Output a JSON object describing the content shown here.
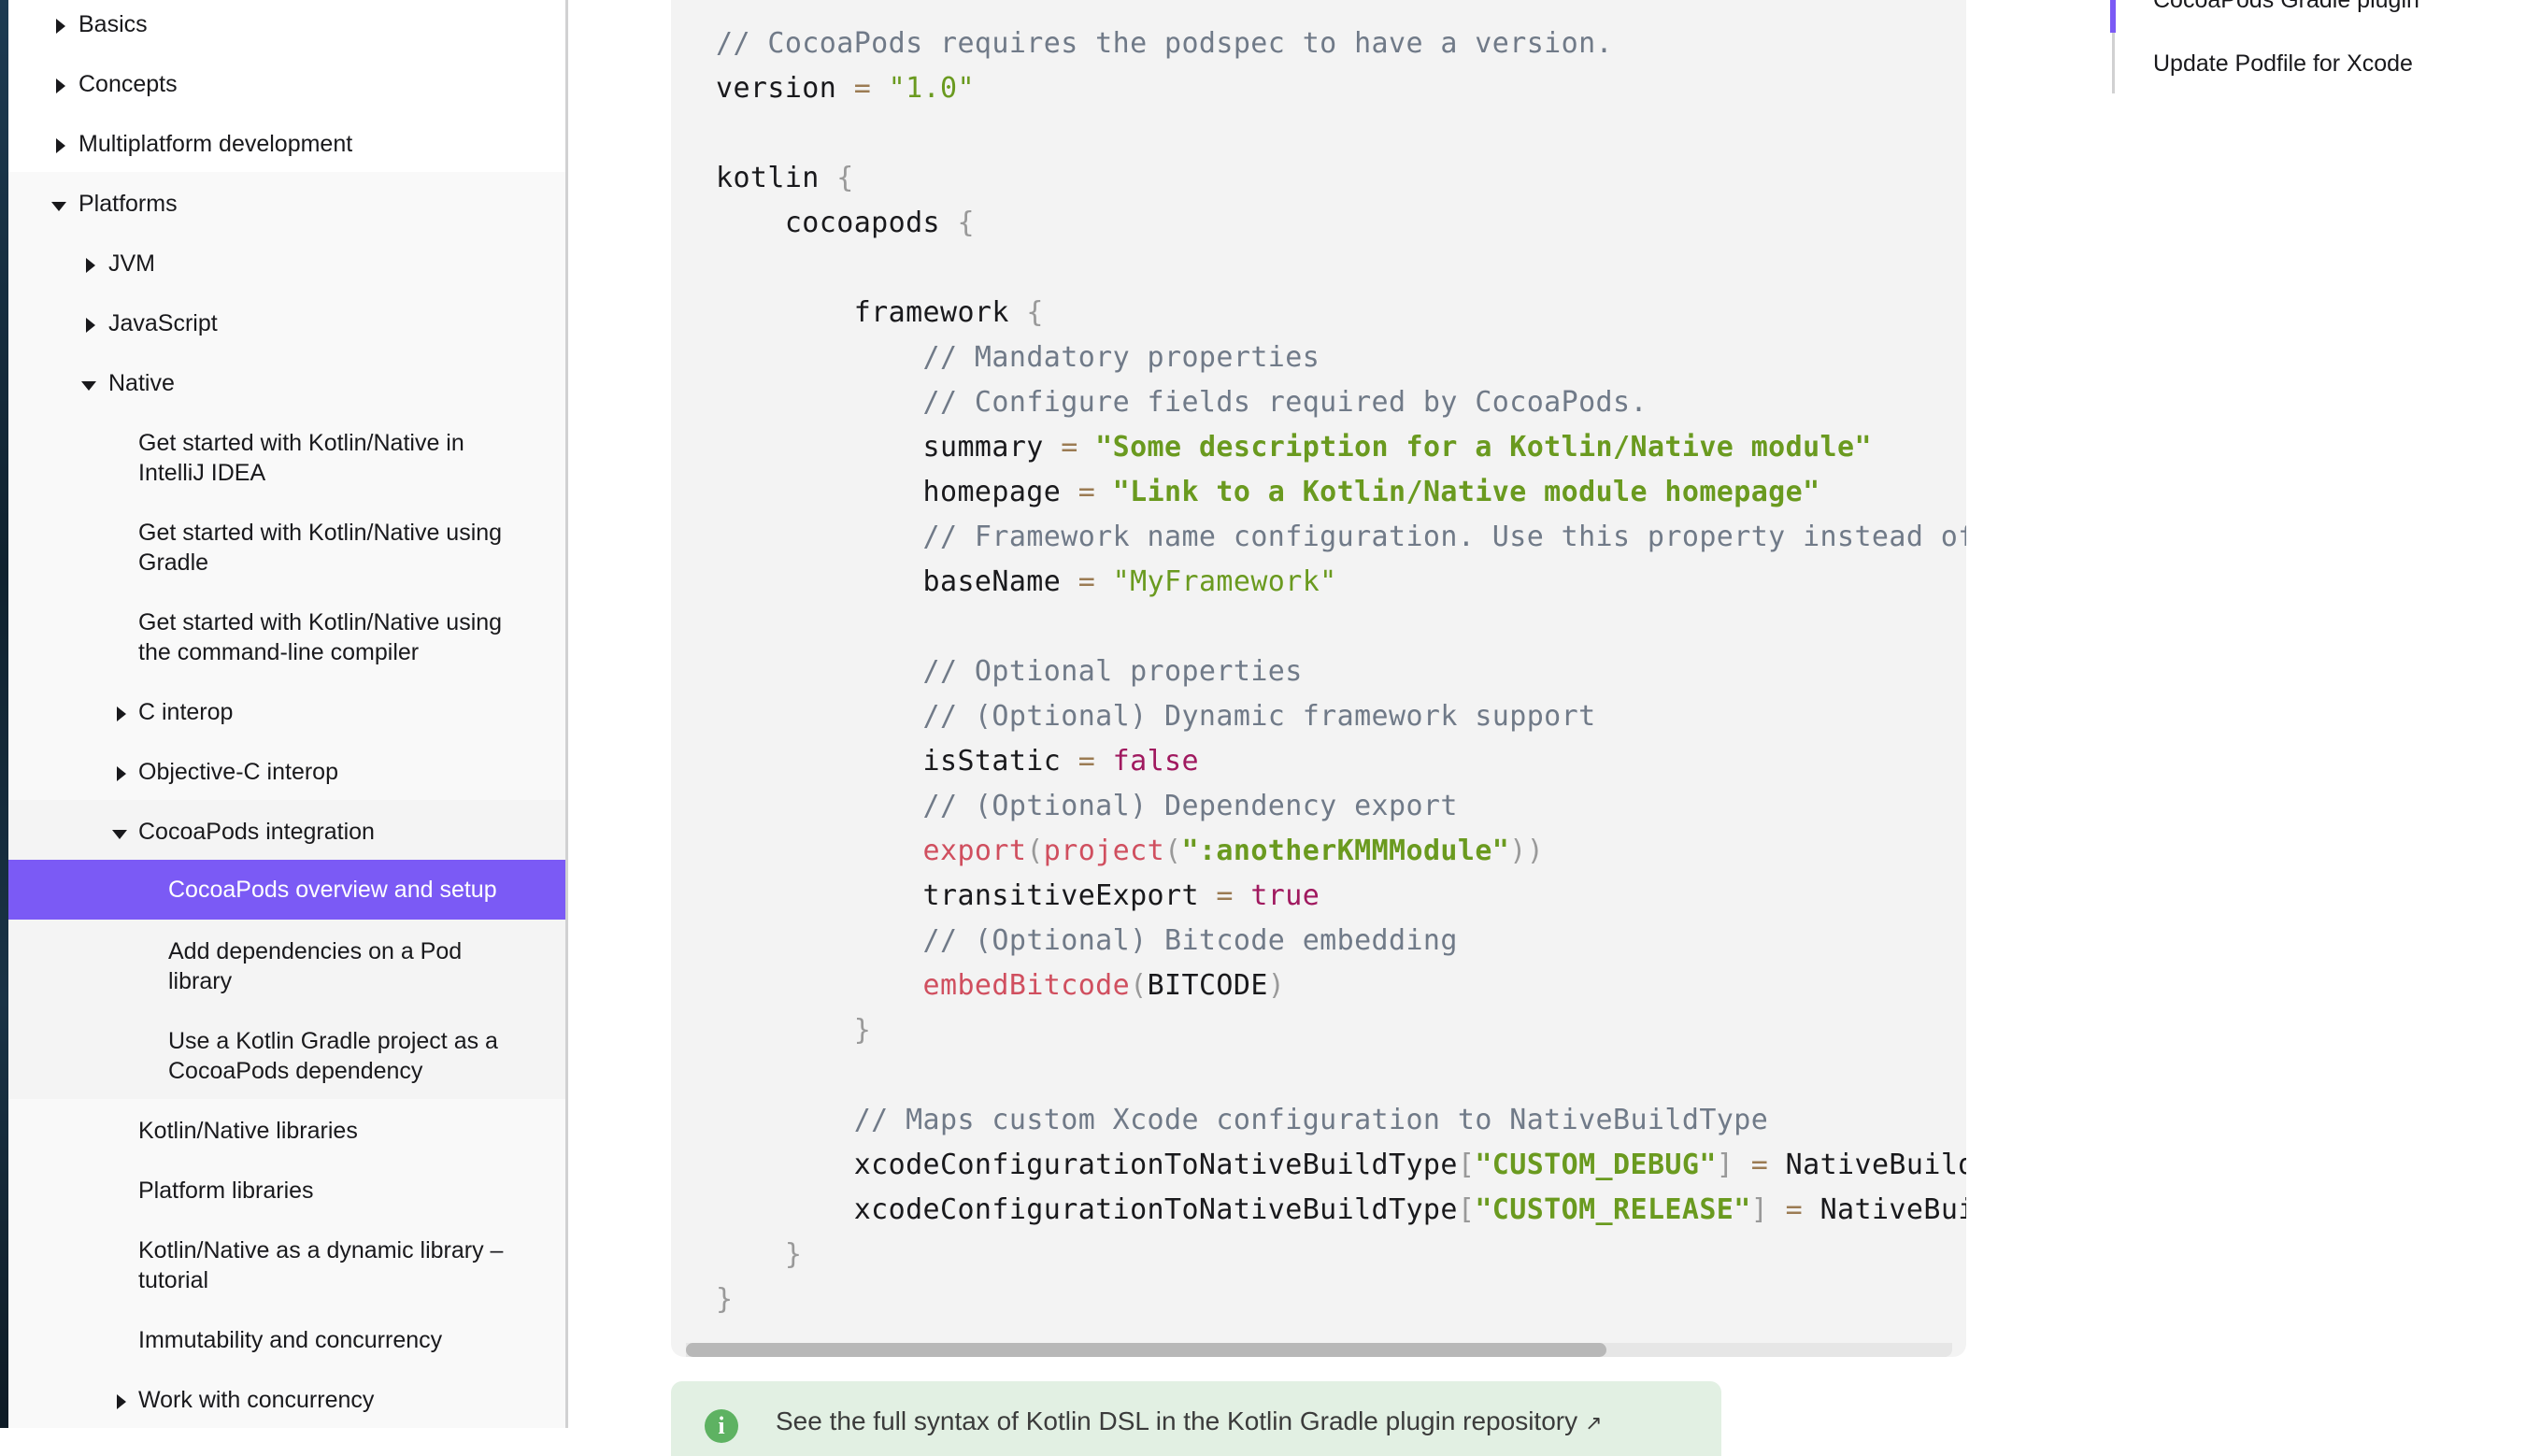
{
  "sidebar": {
    "items": [
      {
        "label": "Basics",
        "arrow": "right"
      },
      {
        "label": "Concepts",
        "arrow": "right"
      },
      {
        "label": "Multiplatform development",
        "arrow": "right"
      },
      {
        "label": "Platforms",
        "arrow": "down"
      },
      {
        "label": "JVM",
        "arrow": "right"
      },
      {
        "label": "JavaScript",
        "arrow": "right"
      },
      {
        "label": "Native",
        "arrow": "down"
      },
      {
        "label_line1": "Get started with Kotlin/Native in",
        "label_line2": "IntelliJ IDEA"
      },
      {
        "label_line1": "Get started with Kotlin/Native using",
        "label_line2": "Gradle"
      },
      {
        "label_line1": "Get started with Kotlin/Native using",
        "label_line2": "the command-line compiler"
      },
      {
        "label": "C interop",
        "arrow": "right"
      },
      {
        "label": "Objective-C interop",
        "arrow": "right"
      },
      {
        "label": "CocoaPods integration",
        "arrow": "down"
      },
      {
        "label": "CocoaPods overview and setup",
        "selected": true
      },
      {
        "label_line1": "Add dependencies on a Pod",
        "label_line2": "library"
      },
      {
        "label_line1": "Use a Kotlin Gradle project as a",
        "label_line2": "CocoaPods dependency"
      },
      {
        "label": "Kotlin/Native libraries"
      },
      {
        "label": "Platform libraries"
      },
      {
        "label_line1": "Kotlin/Native as a dynamic library –",
        "label_line2": "tutorial"
      },
      {
        "label": "Immutability and concurrency"
      },
      {
        "label": "Work with concurrency",
        "arrow": "right"
      }
    ]
  },
  "code": {
    "lines": [
      "// CocoaPods requires the podspec to have a version.",
      "version = \"1.0\"",
      "",
      "kotlin {",
      "    cocoapods {",
      "",
      "        framework {",
      "            // Mandatory properties",
      "            // Configure fields required by CocoaPods.",
      "            summary = \"Some description for a Kotlin/Native module\"",
      "            homepage = \"Link to a Kotlin/Native module homepage\"",
      "            // Framework name configuration. Use this property instead of",
      "            baseName = \"MyFramework\"",
      "",
      "            // Optional properties",
      "            // (Optional) Dynamic framework support",
      "            isStatic = false",
      "            // (Optional) Dependency export",
      "            export(project(\":anotherKMMModule\"))",
      "            transitiveExport = true",
      "            // (Optional) Bitcode embedding",
      "            embedBitcode(BITCODE)",
      "        }",
      "",
      "        // Maps custom Xcode configuration to NativeBuildType",
      "        xcodeConfigurationToNativeBuildType[\"CUSTOM_DEBUG\"] = NativeBuildT",
      "        xcodeConfigurationToNativeBuildType[\"CUSTOM_RELEASE\"] = NativeBuil",
      "    }",
      "}"
    ],
    "horizontal_scroll_fraction": 0.73
  },
  "callout": {
    "icon": "info-icon",
    "text": "See the full syntax of Kotlin DSL in the Kotlin Gradle plugin repository",
    "external_link_glyph": "↗"
  },
  "toc": {
    "items": [
      {
        "label": "CocoaPods Gradle plugin",
        "active": true
      },
      {
        "label": "Update Podfile for Xcode"
      }
    ]
  },
  "colors": {
    "accent": "#7b5af5",
    "code_bg": "#f3f3f3",
    "comment": "#707a88",
    "string": "#6a9a1f",
    "keyword": "#a0195f",
    "function": "#d04f5f",
    "callout_bg": "#e2f0e3"
  }
}
